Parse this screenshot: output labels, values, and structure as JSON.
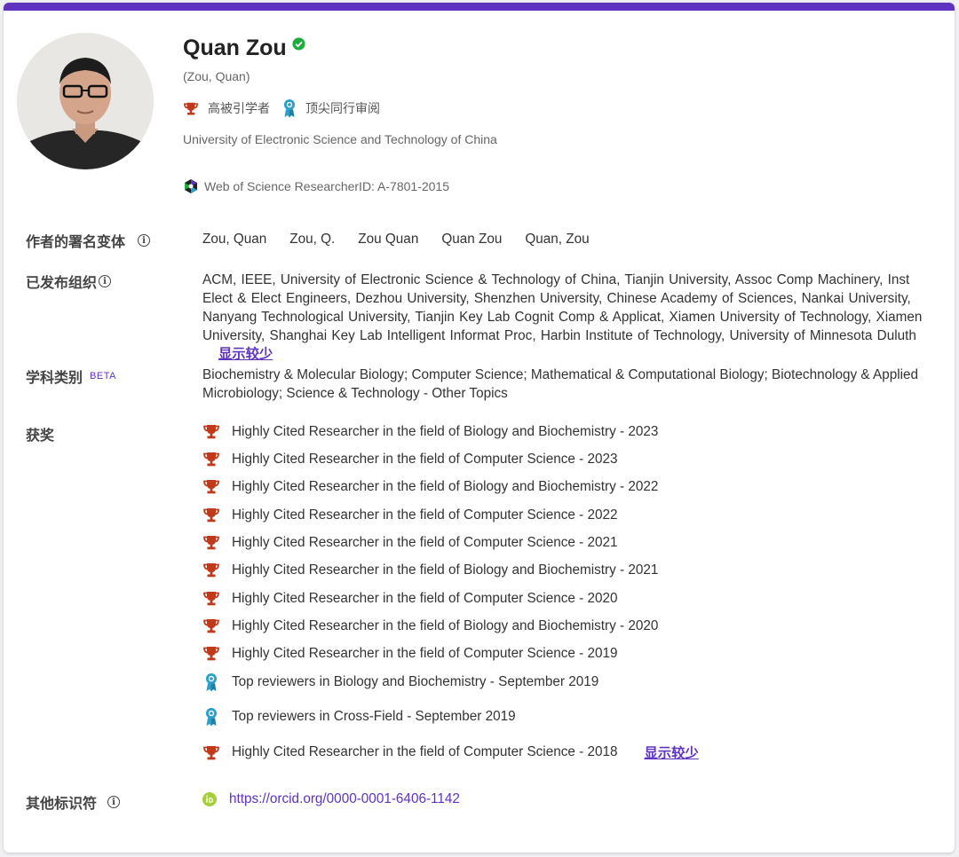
{
  "profile": {
    "name": "Quan Zou",
    "alt_name": "(Zou, Quan)",
    "badges": [
      "高被引学者",
      "顶尖同行审阅"
    ],
    "affiliation": "University of Electronic Science and Technology of China",
    "researcher_id": "Web of Science ResearcherID: A-7801-2015"
  },
  "sections": {
    "variants_label": "作者的署名变体",
    "orgs_label": "已发布组织",
    "categories_label": "学科类别",
    "beta": "BETA",
    "awards_label": "获奖",
    "other_label": "其他标识符"
  },
  "variants": [
    "Zou, Quan",
    "Zou, Q.",
    "Zou Quan",
    "Quan Zou",
    "Quan, Zou"
  ],
  "organizations": "ACM,  IEEE,  University of Electronic Science & Technology of China,  Tianjin University,  Assoc Comp Machinery,  Inst Elect & Elect Engineers,  Dezhou University,  Shenzhen University,  Chinese Academy of Sciences,  Nankai University,  Nanyang Technological University,  Tianjin Key Lab Cognit Comp & Applicat,  Xiamen University of Technology,  Xiamen University,  Shanghai Key Lab Intelligent Informat Proc,  Harbin Institute of Technology,  University of Minnesota Duluth",
  "categories": "Biochemistry & Molecular Biology;  Computer Science;  Mathematical & Computational Biology;  Biotechnology & Applied Microbiology;  Science & Technology - Other Topics",
  "show_less": "显示较少",
  "awards": [
    {
      "icon": "trophy-icon",
      "text": "Highly Cited Researcher in the field of Biology and Biochemistry - 2023"
    },
    {
      "icon": "trophy-icon",
      "text": "Highly Cited Researcher in the field of Computer Science - 2023"
    },
    {
      "icon": "trophy-icon",
      "text": "Highly Cited Researcher in the field of Biology and Biochemistry - 2022"
    },
    {
      "icon": "trophy-icon",
      "text": "Highly Cited Researcher in the field of Computer Science - 2022"
    },
    {
      "icon": "trophy-icon",
      "text": "Highly Cited Researcher in the field of Computer Science - 2021"
    },
    {
      "icon": "trophy-icon",
      "text": "Highly Cited Researcher in the field of Biology and Biochemistry - 2021"
    },
    {
      "icon": "trophy-icon",
      "text": "Highly Cited Researcher in the field of Computer Science - 2020"
    },
    {
      "icon": "trophy-icon",
      "text": "Highly Cited Researcher in the field of Biology and Biochemistry - 2020"
    },
    {
      "icon": "trophy-icon",
      "text": "Highly Cited Researcher in the field of Computer Science - 2019"
    },
    {
      "icon": "reviewer-ribbon-icon",
      "text": "Top reviewers in Biology and Biochemistry - September 2019"
    },
    {
      "icon": "reviewer-ribbon-icon",
      "text": "Top reviewers in Cross-Field - September 2019"
    },
    {
      "icon": "trophy-icon",
      "text": "Highly Cited Researcher in the field of Computer Science - 2018"
    }
  ],
  "orcid": {
    "icon": "orcid-icon",
    "url": "https://orcid.org/0000-0001-6406-1142"
  },
  "colors": {
    "accent": "#5e33bf",
    "trophy": "#c0391b",
    "ribbon": "#2a9fc9",
    "verified": "#1fab3b",
    "orcid": "#a6ce39"
  }
}
